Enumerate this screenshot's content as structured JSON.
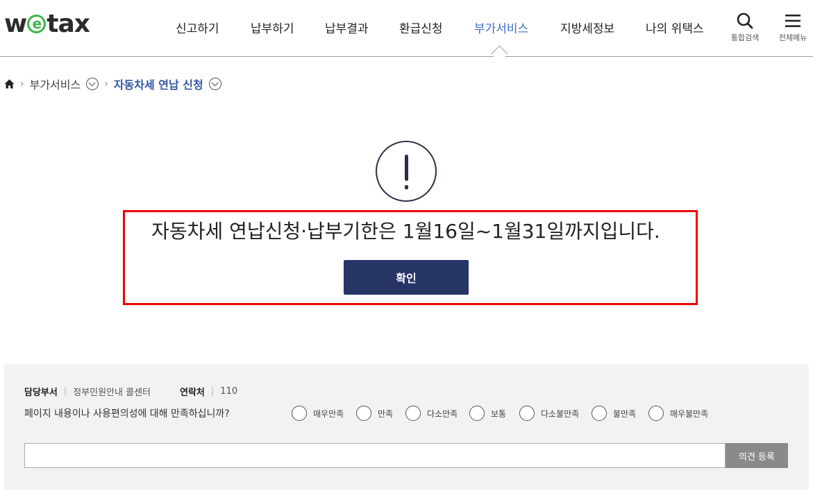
{
  "header": {
    "logo": {
      "pre": "w",
      "circle": "e",
      "post": "tax"
    },
    "nav": [
      {
        "label": "신고하기",
        "active": false
      },
      {
        "label": "납부하기",
        "active": false
      },
      {
        "label": "납부결과",
        "active": false
      },
      {
        "label": "환급신청",
        "active": false
      },
      {
        "label": "부가서비스",
        "active": true
      },
      {
        "label": "지방세정보",
        "active": false
      },
      {
        "label": "나의 위택스",
        "active": false
      }
    ],
    "search_label": "통합검색",
    "menu_label": "전체메뉴"
  },
  "breadcrumb": {
    "home_icon": "home-icon",
    "items": [
      "부가서비스",
      "자동차세 연납 신청"
    ]
  },
  "alert": {
    "icon": "exclamation-icon",
    "message": "자동차세 연납신청·납부기한은 1월16일~1월31일까지입니다.",
    "confirm_label": "확인",
    "highlight_color": "#ee0000"
  },
  "feedback": {
    "dept_key": "담당부서",
    "dept_value": "정부민원안내 콜센터",
    "contact_key": "연락처",
    "contact_value": "110",
    "question": "페이지 내용이나 사용편의성에 대해 만족하십니까?",
    "options": [
      "매우만족",
      "만족",
      "다소만족",
      "보통",
      "다소불만족",
      "불만족",
      "매우불만족"
    ],
    "input_value": "",
    "submit_label": "의견 등록"
  },
  "colors": {
    "accent": "#3d6fc4",
    "button_primary": "#273566",
    "logo_green": "#3cb54a"
  }
}
